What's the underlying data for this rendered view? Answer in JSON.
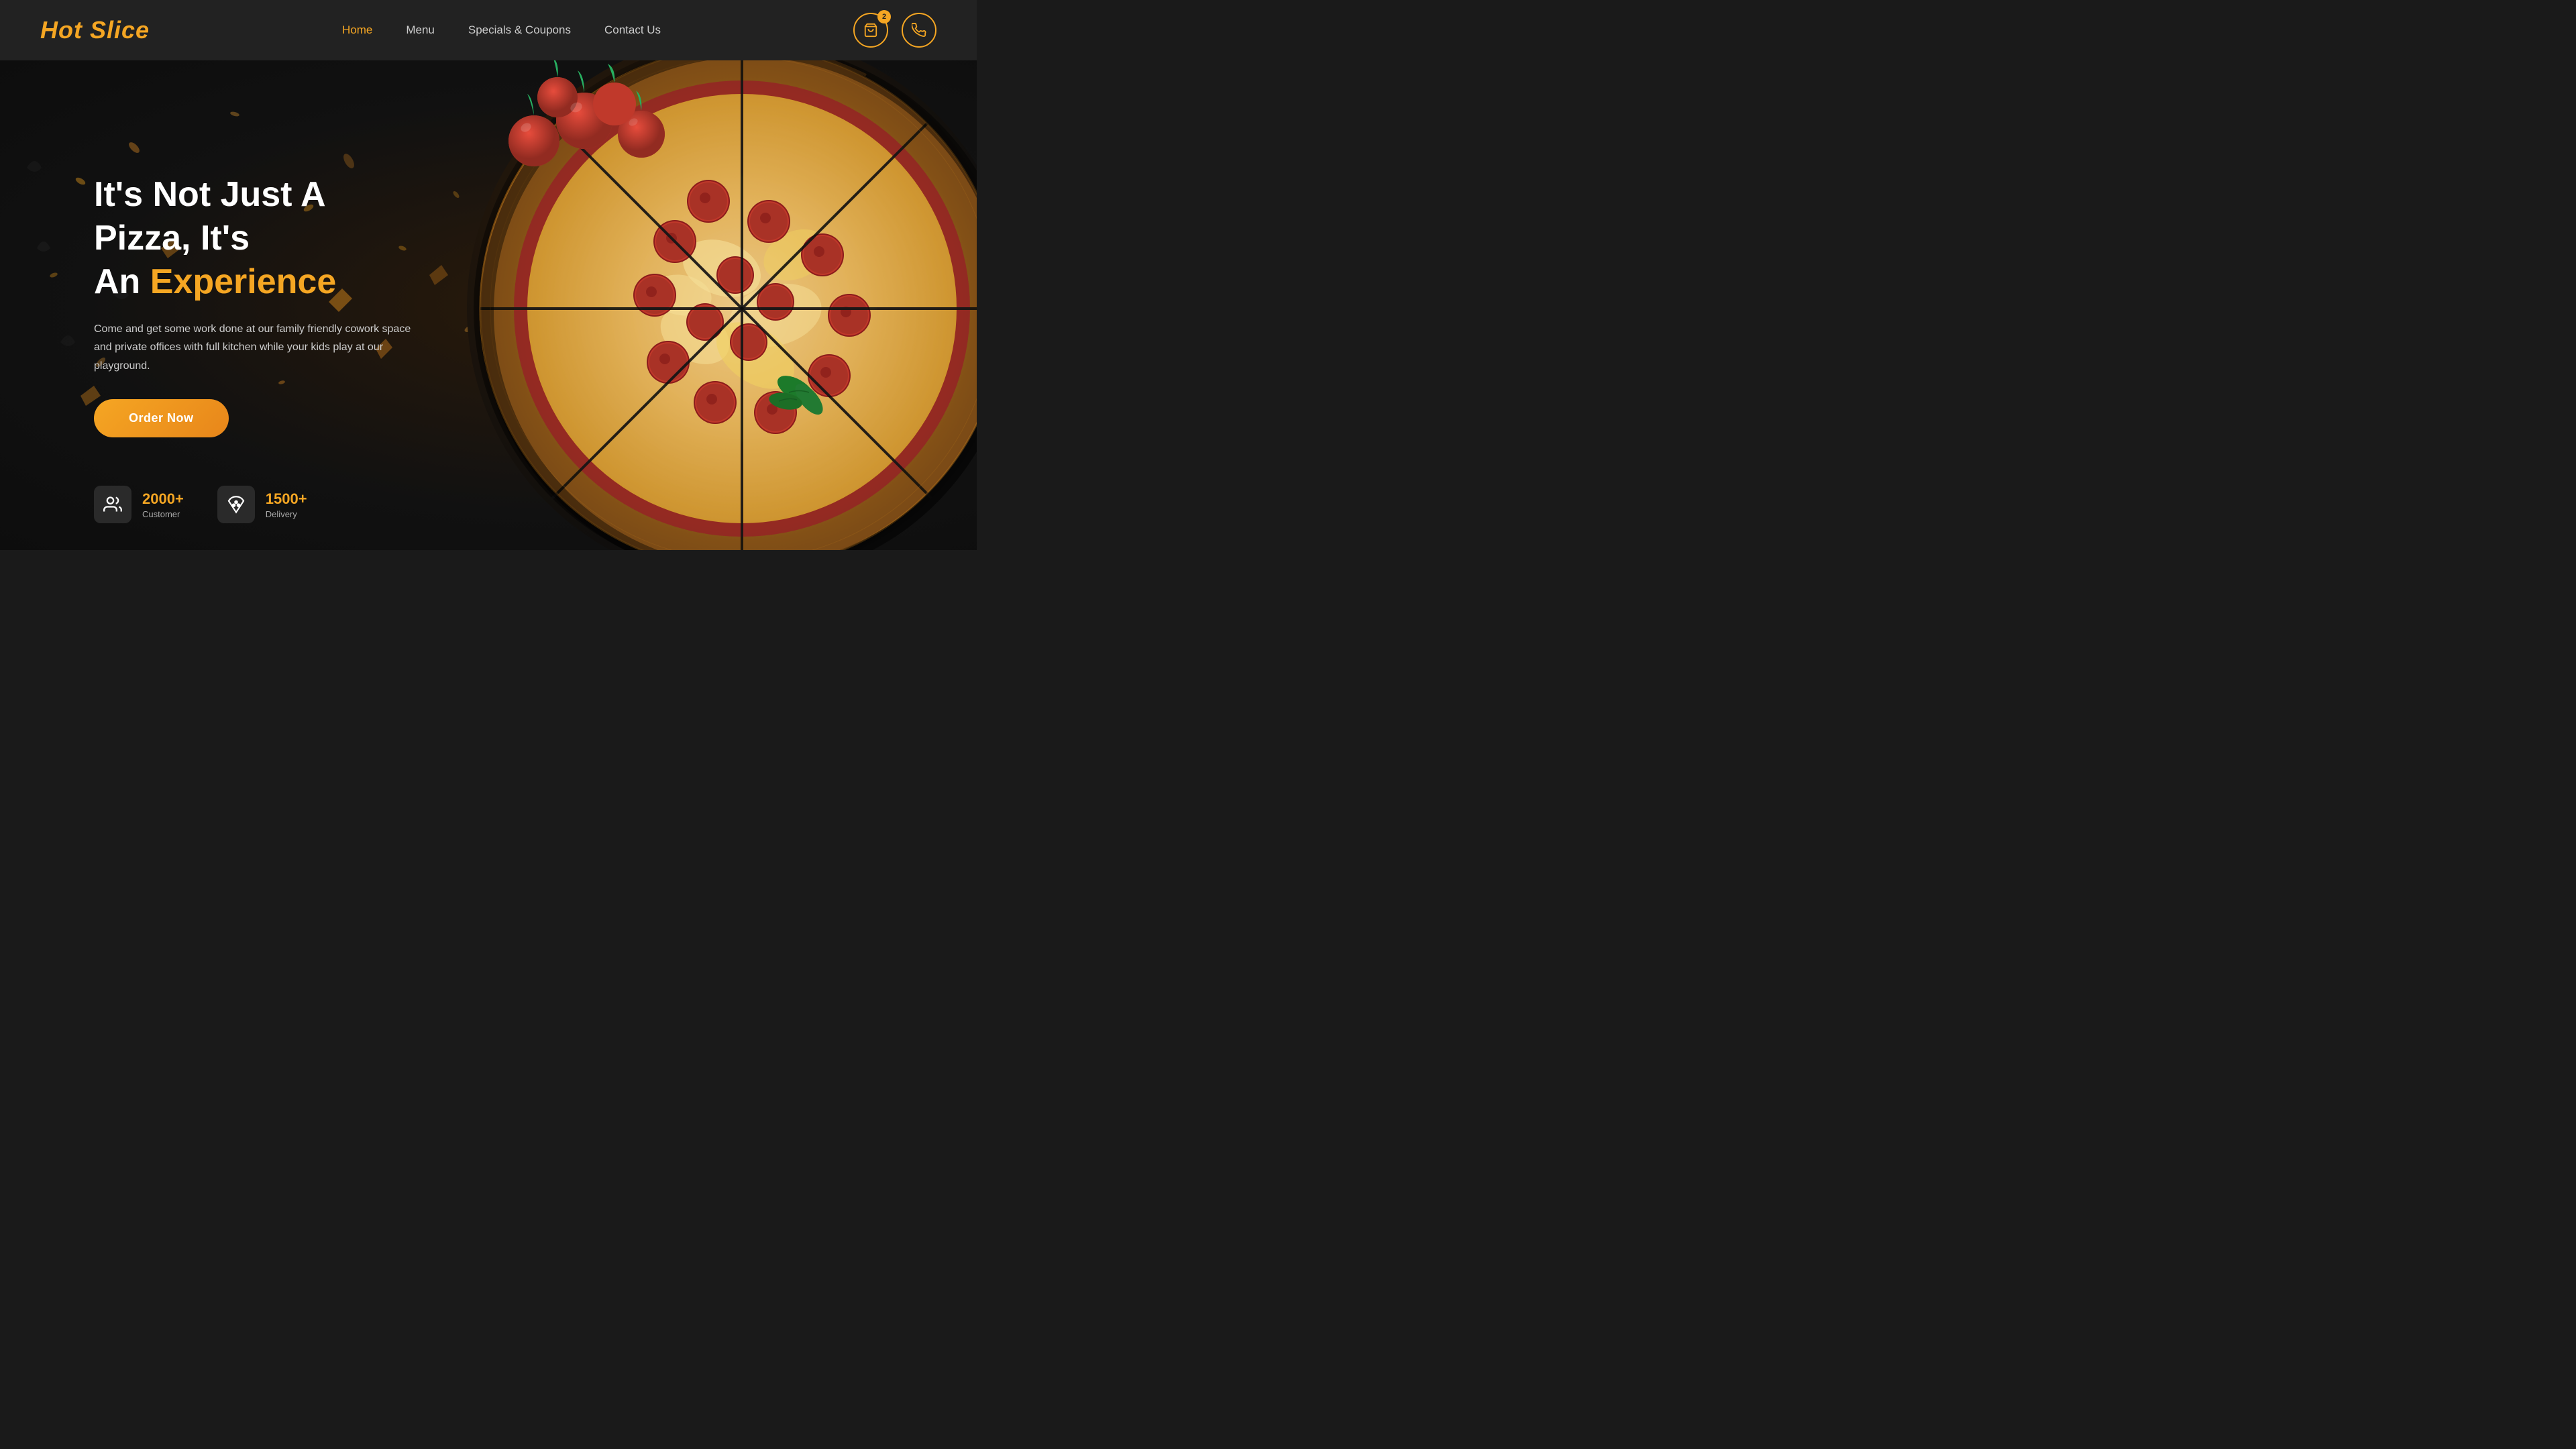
{
  "brand": {
    "name": "Hot Slice"
  },
  "navbar": {
    "links": [
      {
        "label": "Home",
        "active": true
      },
      {
        "label": "Menu",
        "active": false
      },
      {
        "label": "Specials & Coupons",
        "active": false
      },
      {
        "label": "Contact Us",
        "active": false
      }
    ],
    "cart_badge": "2",
    "cart_icon": "shopping-bag",
    "phone_icon": "phone"
  },
  "hero": {
    "title_line1": "It's Not Just A Pizza, It's",
    "title_line2_plain": "An ",
    "title_line2_accent": "Experience",
    "description": "Come and get some work done at our family friendly cowork space and private offices with full kitchen while your kids play at our playground.",
    "cta_label": "Order Now"
  },
  "stats": [
    {
      "number": "2000+",
      "label": "Customer",
      "icon": "users"
    },
    {
      "number": "1500+",
      "label": "Delivery",
      "icon": "pizza-slice"
    }
  ]
}
